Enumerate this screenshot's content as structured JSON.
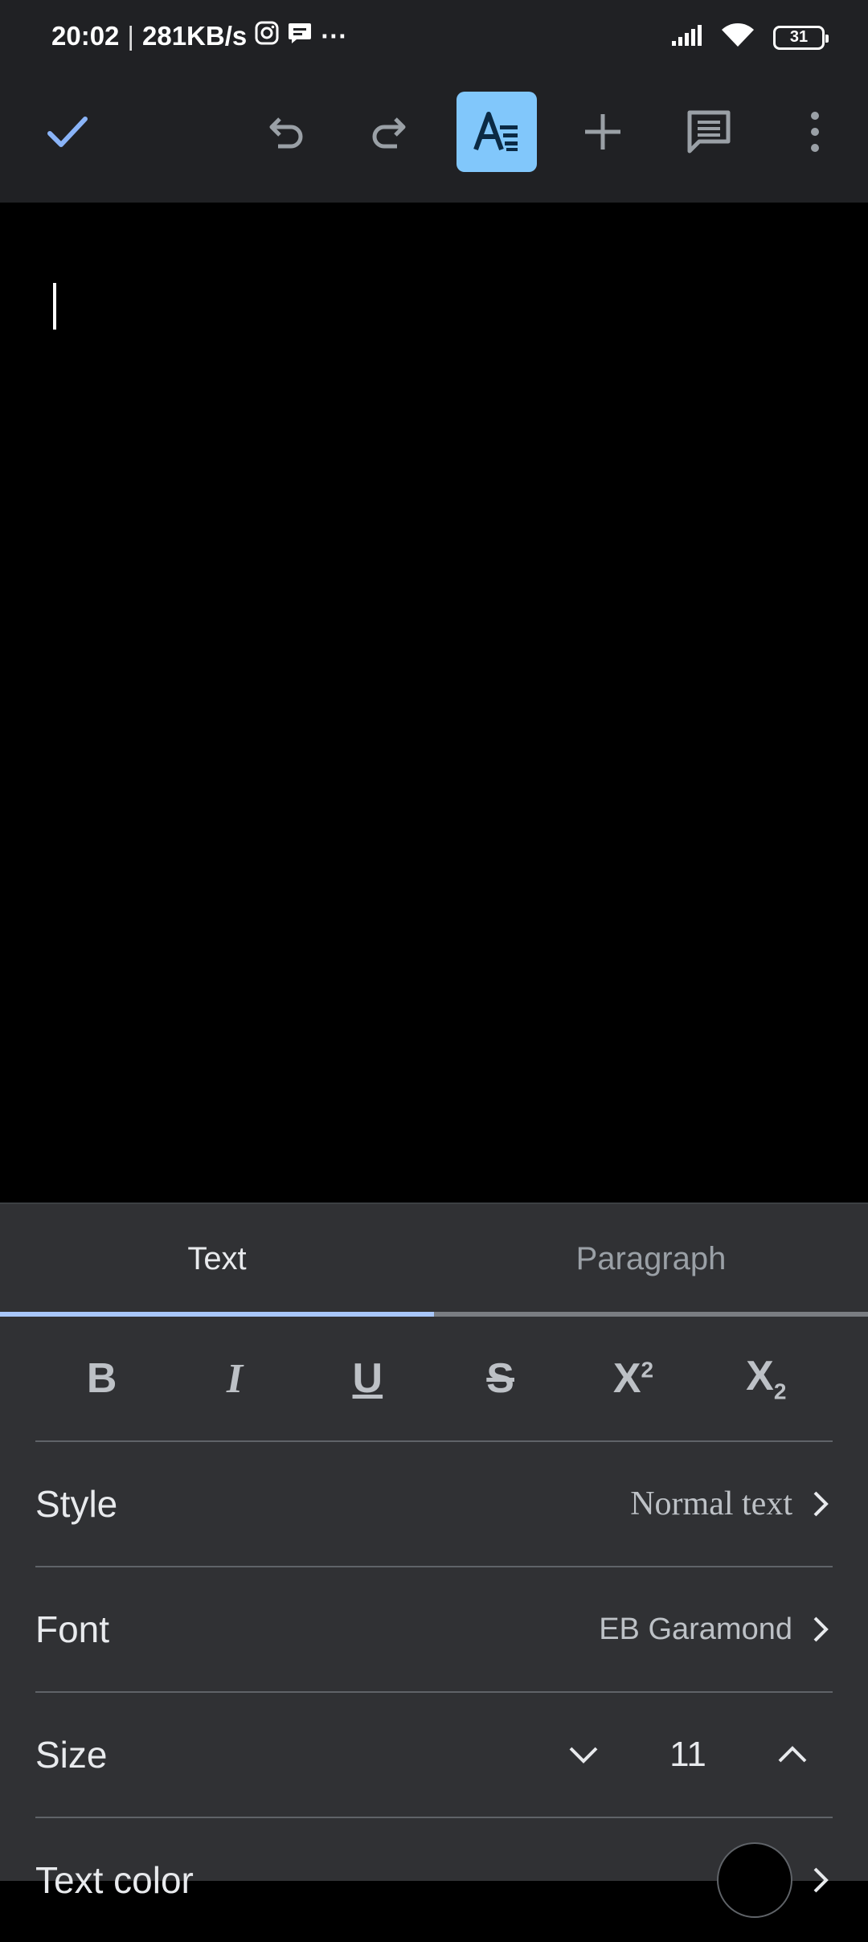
{
  "status_bar": {
    "time": "20:02",
    "separator": "|",
    "net_speed": "281KB/s",
    "more": "···",
    "battery": "31"
  },
  "toolbar": {
    "icons": [
      "check-icon",
      "undo-icon",
      "redo-icon",
      "text-format-icon",
      "add-icon",
      "comment-icon",
      "more-vert-icon"
    ],
    "active": "text-format-icon",
    "accent": "#8ab4f8"
  },
  "format_panel": {
    "tabs": [
      {
        "label": "Text",
        "active": true
      },
      {
        "label": "Paragraph",
        "active": false
      }
    ],
    "format_buttons": {
      "bold": "B",
      "italic": "I",
      "underline": "U",
      "strikethrough": "S",
      "superscript_base": "X",
      "superscript_mark": "2",
      "subscript_base": "X",
      "subscript_mark": "2"
    },
    "style": {
      "label": "Style",
      "value": "Normal text"
    },
    "font": {
      "label": "Font",
      "value": "EB Garamond"
    },
    "size": {
      "label": "Size",
      "value": "11"
    },
    "text_color": {
      "label": "Text color",
      "value_color": "#000000"
    }
  }
}
